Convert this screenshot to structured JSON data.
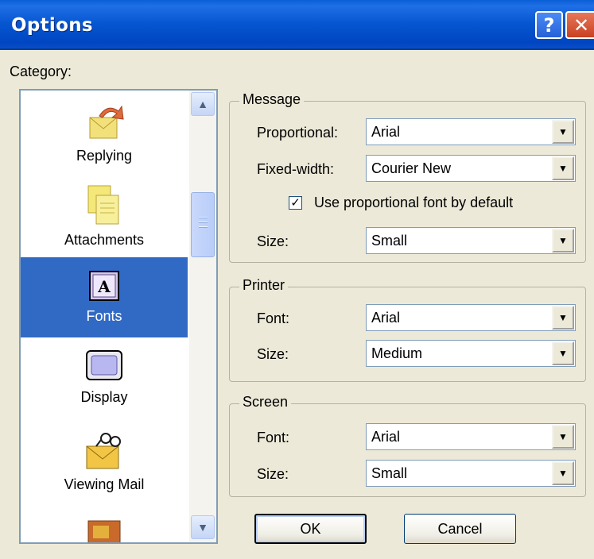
{
  "window": {
    "title": "Options"
  },
  "category": {
    "label": "Category:",
    "items": [
      {
        "label": "Replying",
        "icon": "replying-icon"
      },
      {
        "label": "Attachments",
        "icon": "attachments-icon"
      },
      {
        "label": "Fonts",
        "icon": "fonts-icon",
        "selected": true
      },
      {
        "label": "Display",
        "icon": "display-icon"
      },
      {
        "label": "Viewing Mail",
        "icon": "viewing-mail-icon"
      }
    ]
  },
  "message": {
    "title": "Message",
    "proportional_label": "Proportional:",
    "proportional_value": "Arial",
    "fixed_width_label": "Fixed-width:",
    "fixed_width_value": "Courier New",
    "use_proportional_label": "Use proportional font by default",
    "use_proportional_checked": true,
    "size_label": "Size:",
    "size_value": "Small"
  },
  "printer": {
    "title": "Printer",
    "font_label": "Font:",
    "font_value": "Arial",
    "size_label": "Size:",
    "size_value": "Medium"
  },
  "screen": {
    "title": "Screen",
    "font_label": "Font:",
    "font_value": "Arial",
    "size_label": "Size:",
    "size_value": "Small"
  },
  "buttons": {
    "ok": "OK",
    "cancel": "Cancel"
  },
  "colors": {
    "title_bar": "#0655d0",
    "selection": "#316ac5",
    "dialog_bg": "#ece9d8"
  }
}
